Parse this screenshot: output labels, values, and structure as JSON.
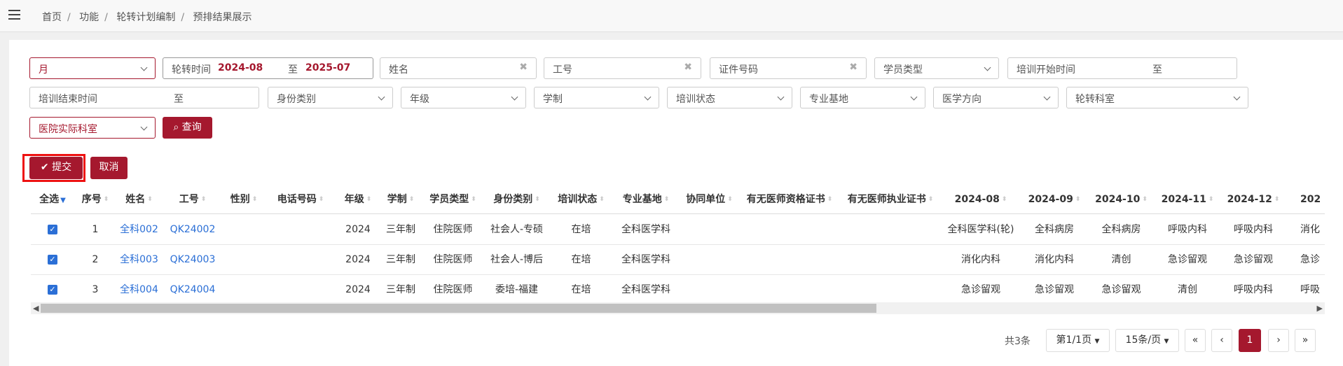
{
  "breadcrumb": [
    "首页",
    "功能",
    "轮转计划编制",
    "预排结果展示"
  ],
  "filters": {
    "period": "月",
    "rotation_time_label": "轮转时间",
    "rotation_start": "2024-08",
    "rotation_to": "至",
    "rotation_end": "2025-07",
    "name_placeholder": "姓名",
    "staff_no_placeholder": "工号",
    "id_no_placeholder": "证件号码",
    "trainee_type": "学员类型",
    "train_start_label": "培训开始时间",
    "train_start_to": "至",
    "train_end_label": "培训结束时间",
    "train_end_to": "至",
    "identity_type": "身份类别",
    "grade": "年级",
    "program_length": "学制",
    "train_status": "培训状态",
    "base": "专业基地",
    "direction": "医学方向",
    "rotation_dept": "轮转科室",
    "hospital_dept": "医院实际科室",
    "query_button": "查询"
  },
  "actions": {
    "submit": "提交",
    "cancel": "取消"
  },
  "table": {
    "headers": [
      "全选",
      "序号",
      "姓名",
      "工号",
      "性别",
      "电话号码",
      "年级",
      "学制",
      "学员类型",
      "身份类别",
      "培训状态",
      "专业基地",
      "协同单位",
      "有无医师资格证书",
      "有无医师执业证书",
      "2024-08",
      "2024-09",
      "2024-10",
      "2024-11",
      "2024-12",
      "202"
    ],
    "rows": [
      {
        "no": "1",
        "name": "全科002",
        "staff": "QK24002",
        "grade": "2024",
        "len": "三年制",
        "type": "住院医师",
        "identity": "社会人-专硕",
        "status": "在培",
        "base": "全科医学科",
        "m1": "全科医学科(轮)",
        "m2": "全科病房",
        "m3": "全科病房",
        "m4": "呼吸内科",
        "m5": "呼吸内科",
        "m6": "消化"
      },
      {
        "no": "2",
        "name": "全科003",
        "staff": "QK24003",
        "grade": "2024",
        "len": "三年制",
        "type": "住院医师",
        "identity": "社会人-博后",
        "status": "在培",
        "base": "全科医学科",
        "m1": "消化内科",
        "m2": "消化内科",
        "m3": "清创",
        "m4": "急诊留观",
        "m5": "急诊留观",
        "m6": "急诊"
      },
      {
        "no": "3",
        "name": "全科004",
        "staff": "QK24004",
        "grade": "2024",
        "len": "三年制",
        "type": "住院医师",
        "identity": "委培-福建",
        "status": "在培",
        "base": "全科医学科",
        "m1": "急诊留观",
        "m2": "急诊留观",
        "m3": "急诊留观",
        "m4": "清创",
        "m5": "呼吸内科",
        "m6": "呼吸"
      }
    ]
  },
  "pagination": {
    "total": "共3条",
    "page": "第1/1页",
    "page_size": "15条/页",
    "first": "«",
    "prev": "‹",
    "current": "1",
    "next": "›",
    "last": "»"
  },
  "colors": {
    "accent": "#a5182e",
    "link": "#2b6fd6"
  }
}
